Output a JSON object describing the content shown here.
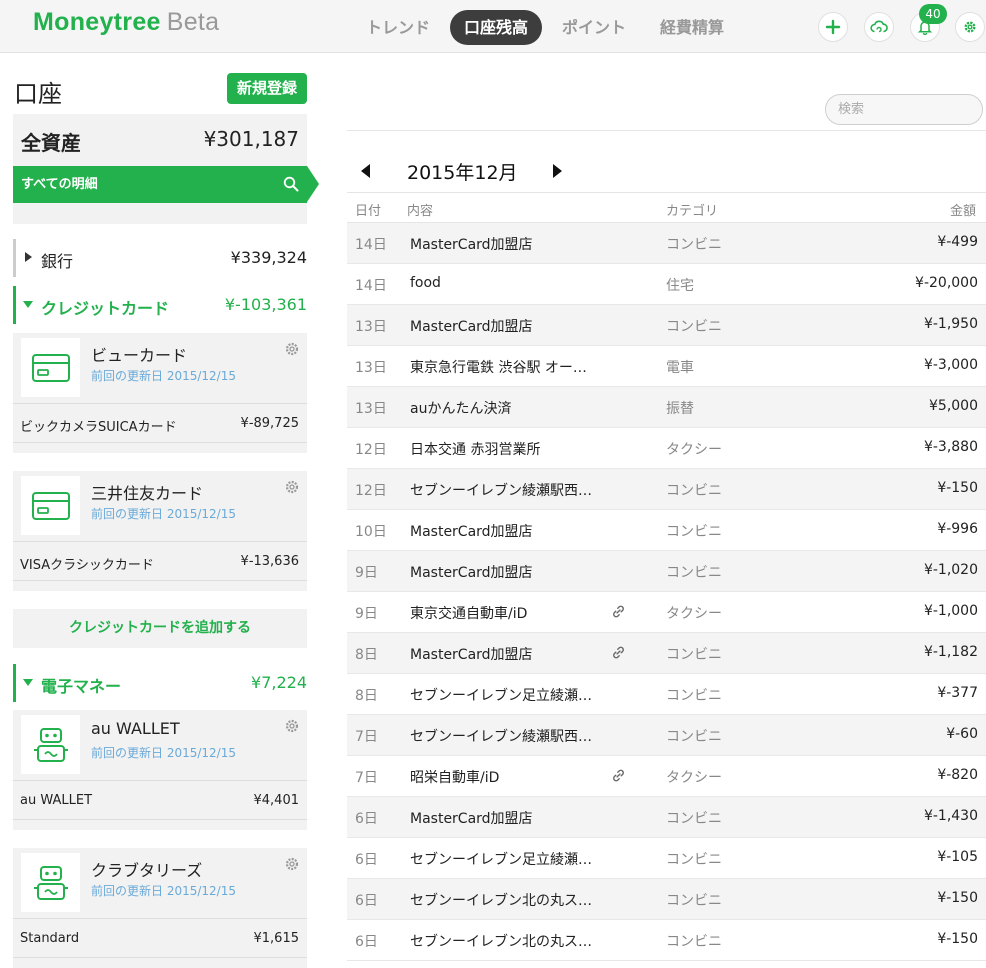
{
  "header": {
    "logo": "Moneytree",
    "logo_suffix": "Beta",
    "tabs": [
      {
        "label": "トレンド",
        "active": false
      },
      {
        "label": "口座残高",
        "active": true
      },
      {
        "label": "ポイント",
        "active": false
      },
      {
        "label": "経費精算",
        "active": false
      }
    ],
    "notification_count": "40",
    "accent_color": "#22b14c"
  },
  "sidebar": {
    "title": "口座",
    "new_button": "新規登録",
    "total_label": "全資産",
    "total_value": "¥301,187",
    "all_transactions": "すべての明細",
    "groups": {
      "bank": {
        "label": "銀行",
        "value": "¥339,324"
      },
      "credit": {
        "label": "クレジットカード",
        "value": "¥-103,361"
      },
      "emoney": {
        "label": "電子マネー",
        "value": "¥7,224"
      }
    },
    "cards": [
      {
        "name": "ビューカード",
        "date": "前回の更新日 2015/12/15",
        "sub_name": "ビックカメラSUICAカード",
        "sub_value": "¥-89,725"
      },
      {
        "name": "三井住友カード",
        "date": "前回の更新日 2015/12/15",
        "sub_name": "VISAクラシックカード",
        "sub_value": "¥-13,636"
      },
      {
        "name": "au WALLET",
        "date": "前回の更新日 2015/12/15",
        "sub_name": "au WALLET",
        "sub_value": "¥4,401"
      },
      {
        "name": "クラブタリーズ",
        "date": "前回の更新日 2015/12/15",
        "sub_name": "Standard",
        "sub_value": "¥1,615"
      }
    ],
    "add_credit": "クレジットカードを追加する"
  },
  "main": {
    "search_placeholder": "検索",
    "month": "2015年12月",
    "columns": {
      "date": "日付",
      "desc": "内容",
      "category": "カテゴリ",
      "amount": "金額"
    },
    "rows": [
      {
        "date": "14日",
        "desc": "MasterCard加盟店",
        "category": "コンビニ",
        "amount": "¥-499",
        "link": false
      },
      {
        "date": "14日",
        "desc": "food",
        "category": "住宅",
        "amount": "¥-20,000",
        "link": false
      },
      {
        "date": "13日",
        "desc": "MasterCard加盟店",
        "category": "コンビニ",
        "amount": "¥-1,950",
        "link": false
      },
      {
        "date": "13日",
        "desc": "東京急行電鉄 渋谷駅 オー…",
        "category": "電車",
        "amount": "¥-3,000",
        "link": false
      },
      {
        "date": "13日",
        "desc": "auかんたん決済",
        "category": "振替",
        "amount": "¥5,000",
        "link": false
      },
      {
        "date": "12日",
        "desc": "日本交通 赤羽営業所",
        "category": "タクシー",
        "amount": "¥-3,880",
        "link": false
      },
      {
        "date": "12日",
        "desc": "セブンーイレブン綾瀬駅西…",
        "category": "コンビニ",
        "amount": "¥-150",
        "link": false
      },
      {
        "date": "10日",
        "desc": "MasterCard加盟店",
        "category": "コンビニ",
        "amount": "¥-996",
        "link": false
      },
      {
        "date": "9日",
        "desc": "MasterCard加盟店",
        "category": "コンビニ",
        "amount": "¥-1,020",
        "link": false
      },
      {
        "date": "9日",
        "desc": "東京交通自動車/iD",
        "category": "タクシー",
        "amount": "¥-1,000",
        "link": true
      },
      {
        "date": "8日",
        "desc": "MasterCard加盟店",
        "category": "コンビニ",
        "amount": "¥-1,182",
        "link": true
      },
      {
        "date": "8日",
        "desc": "セブンーイレブン足立綾瀬…",
        "category": "コンビニ",
        "amount": "¥-377",
        "link": false
      },
      {
        "date": "7日",
        "desc": "セブンーイレブン綾瀬駅西…",
        "category": "コンビニ",
        "amount": "¥-60",
        "link": false
      },
      {
        "date": "7日",
        "desc": "昭栄自動車/iD",
        "category": "タクシー",
        "amount": "¥-820",
        "link": true
      },
      {
        "date": "6日",
        "desc": "MasterCard加盟店",
        "category": "コンビニ",
        "amount": "¥-1,430",
        "link": false
      },
      {
        "date": "6日",
        "desc": "セブンーイレブン足立綾瀬…",
        "category": "コンビニ",
        "amount": "¥-105",
        "link": false
      },
      {
        "date": "6日",
        "desc": "セブンーイレブン北の丸ス…",
        "category": "コンビニ",
        "amount": "¥-150",
        "link": false
      },
      {
        "date": "6日",
        "desc": "セブンーイレブン北の丸ス…",
        "category": "コンビニ",
        "amount": "¥-150",
        "link": false
      }
    ]
  }
}
